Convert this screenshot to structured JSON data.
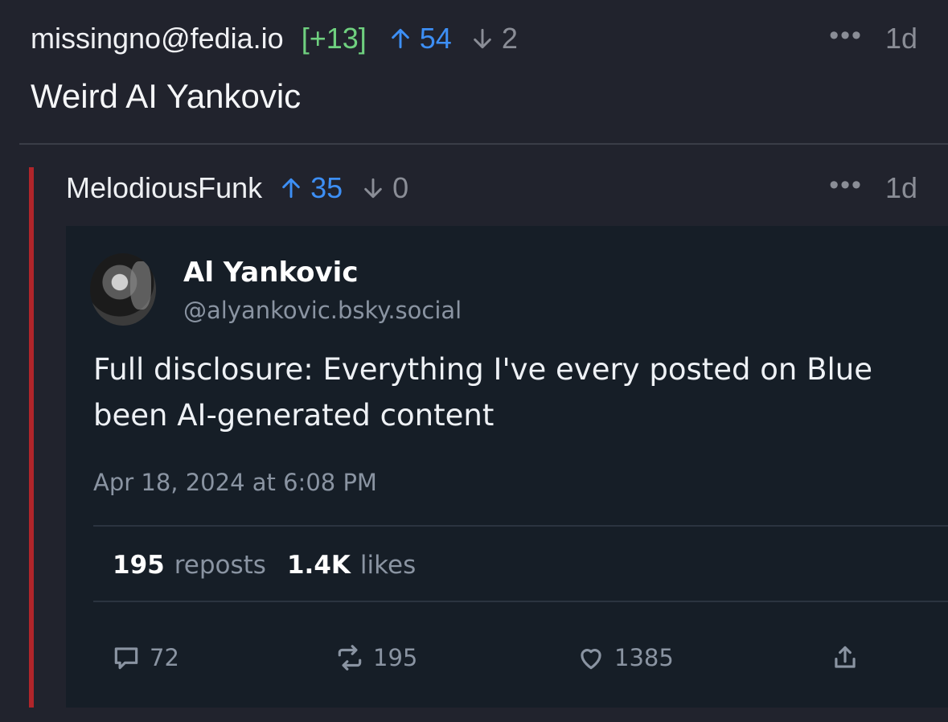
{
  "post": {
    "username": "missingno@fedia.io",
    "score": "[+13]",
    "upvotes": "54",
    "downvotes": "2",
    "more": "•••",
    "age": "1d",
    "title": "Weird AI Yankovic"
  },
  "comment": {
    "username": "MelodiousFunk",
    "upvotes": "35",
    "downvotes": "0",
    "more": "•••",
    "age": "1d",
    "embed": {
      "display_name": "Al Yankovic",
      "handle": "@alyankovic.bsky.social",
      "text_line1": "Full disclosure: Everything I've every posted on Blue",
      "text_line2": "been AI-generated content",
      "timestamp": "Apr 18, 2024 at 6:08 PM",
      "reposts_count": "195",
      "reposts_label": "reposts",
      "likes_count": "1.4K",
      "likes_label": "likes",
      "reply_count": "72",
      "repost_count": "195",
      "like_count": "1385"
    }
  },
  "icons": [
    "arrow-up-icon",
    "arrow-down-icon",
    "more-icon",
    "reply-icon",
    "repost-icon",
    "heart-icon",
    "share-icon"
  ],
  "colors": {
    "background": "#21232d",
    "upvote": "#3d8ff5",
    "score": "#6fd07f",
    "rail": "#b0252a",
    "card": "#161e27"
  }
}
